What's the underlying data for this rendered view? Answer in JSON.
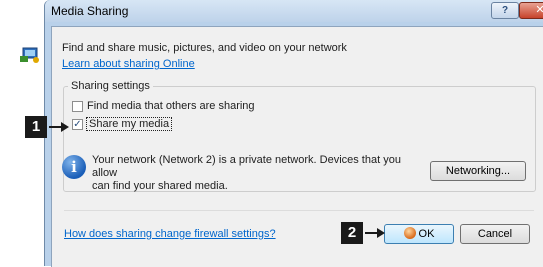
{
  "window": {
    "title": "Media Sharing",
    "help_label": "?",
    "close_label": "✕"
  },
  "intro": {
    "text": "Find and share music, pictures, and video on your network",
    "link": "Learn about sharing Online"
  },
  "sharing_settings": {
    "title": "Sharing settings",
    "options": [
      {
        "label": "Find media that others are sharing",
        "checked": false
      },
      {
        "label": "Share my media",
        "checked": true
      }
    ]
  },
  "network_info": {
    "line1": "Your network (Network  2) is a private network. Devices that you allow",
    "line2": "can find your shared media."
  },
  "buttons": {
    "networking": "Networking...",
    "ok": "OK",
    "cancel": "Cancel"
  },
  "footer": {
    "firewall_link": "How does sharing change firewall settings?"
  },
  "callouts": {
    "one": "1",
    "two": "2"
  },
  "colors": {
    "link": "#0066cc",
    "titlebar": "#bed3ea",
    "callout": "#1a1a1a"
  },
  "icons": [
    "media-sharing-icon",
    "info-icon",
    "shield-icon",
    "arrow-right-icon"
  ]
}
